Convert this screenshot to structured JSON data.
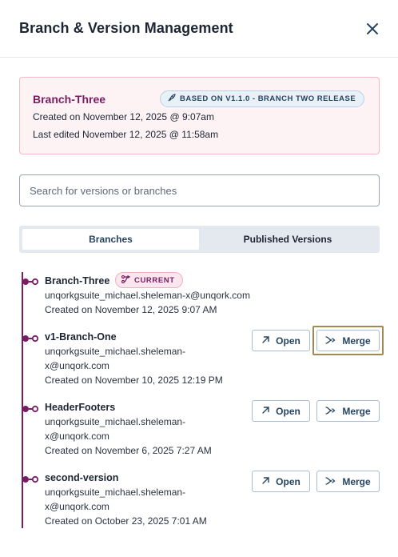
{
  "header": {
    "title": "Branch & Version Management",
    "close_icon": "close-icon"
  },
  "info_card": {
    "branch_name": "Branch-Three",
    "based_on": "BASED ON V1.1.0 - BRANCH TWO RELEASE",
    "created": "Created on November 12, 2025 @ 9:07am",
    "last_edited": "Last edited November 12, 2025 @ 11:58am"
  },
  "search": {
    "placeholder": "Search for versions or branches",
    "value": ""
  },
  "tabs": [
    {
      "label": "Branches",
      "active": true
    },
    {
      "label": "Published Versions",
      "active": false
    }
  ],
  "branches": [
    {
      "name": "Branch-Three",
      "badge": "CURRENT",
      "email_line1": "unqorkgsuite_michael.sheleman-x@unqork.com",
      "email_line2": "",
      "created": "Created on November 12, 2025 9:07 AM"
    },
    {
      "name": "v1-Branch-One",
      "email_line1": "unqorkgsuite_michael.sheleman-",
      "email_line2": "x@unqork.com",
      "created": "Created on November 10, 2025 12:19 PM"
    },
    {
      "name": "HeaderFooters",
      "email_line1": "unqorkgsuite_michael.sheleman-",
      "email_line2": "x@unqork.com",
      "created": "Created on November 6, 2025 7:27 AM"
    },
    {
      "name": "second-version",
      "email_line1": "unqorkgsuite_michael.sheleman-",
      "email_line2": "x@unqork.com",
      "created": "Created on October 23, 2025 7:01 AM"
    }
  ],
  "actions": {
    "open_label": "Open",
    "merge_label": "Merge"
  },
  "colors": {
    "accent": "#7b1c63",
    "button_text": "#27445f",
    "card_bg": "#fdf3f5",
    "focus_outline": "#a08a54"
  }
}
